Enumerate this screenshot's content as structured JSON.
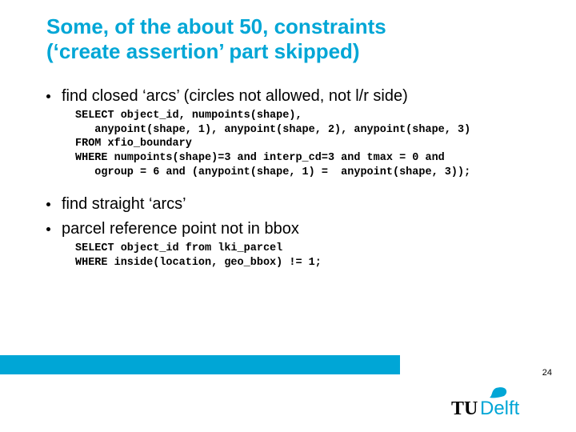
{
  "title_line1": "Some, of the about 50, constraints",
  "title_line2": "(‘create assertion’ part skipped)",
  "bullets": {
    "b1": "find closed ‘arcs’ (circles not allowed, not l/r side)",
    "b2": "find straight ‘arcs’",
    "b3": "parcel reference point not in bbox"
  },
  "code1": "SELECT object_id, numpoints(shape),\n   anypoint(shape, 1), anypoint(shape, 2), anypoint(shape, 3)\nFROM xfio_boundary\nWHERE numpoints(shape)=3 and interp_cd=3 and tmax = 0 and\n   ogroup = 6 and (anypoint(shape, 1) =  anypoint(shape, 3));",
  "code2": "SELECT object_id from lki_parcel\nWHERE inside(location, geo_bbox) != 1;",
  "page_number": "24",
  "logo_text": "TUDelft"
}
